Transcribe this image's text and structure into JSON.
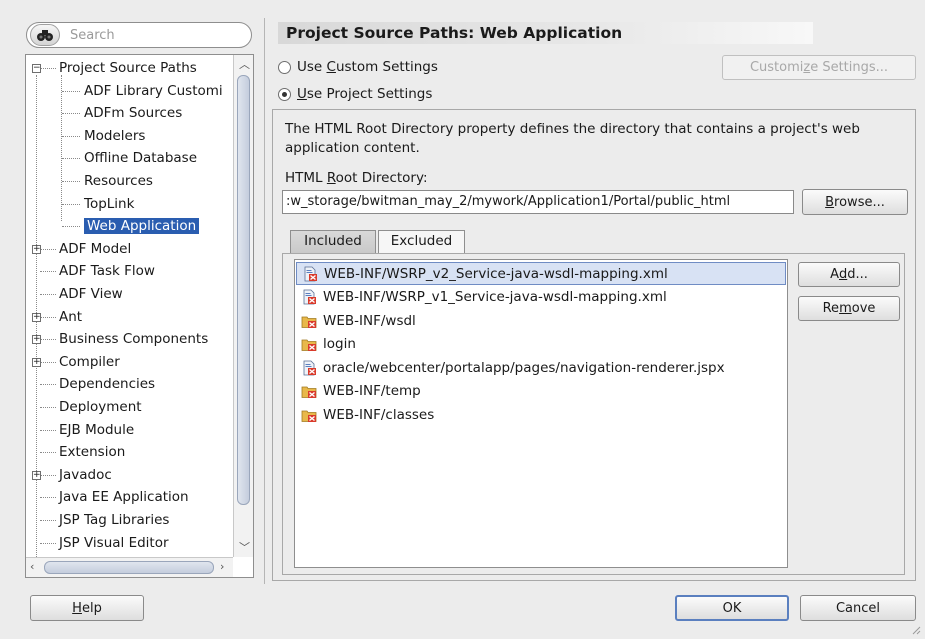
{
  "search": {
    "placeholder": "Search"
  },
  "tree": {
    "items": [
      {
        "label": "Project Source Paths",
        "expander": "-"
      },
      {
        "label": "ADF Library Customi"
      },
      {
        "label": "ADFm Sources"
      },
      {
        "label": "Modelers"
      },
      {
        "label": "Offline Database"
      },
      {
        "label": "Resources"
      },
      {
        "label": "TopLink"
      },
      {
        "label": "Web Application",
        "selected": true
      },
      {
        "label": "ADF Model",
        "expander": "+"
      },
      {
        "label": "ADF Task Flow"
      },
      {
        "label": "ADF View"
      },
      {
        "label": "Ant",
        "expander": "+"
      },
      {
        "label": "Business Components",
        "expander": "+"
      },
      {
        "label": "Compiler",
        "expander": "+"
      },
      {
        "label": "Dependencies"
      },
      {
        "label": "Deployment"
      },
      {
        "label": "EJB Module"
      },
      {
        "label": "Extension"
      },
      {
        "label": "Javadoc",
        "expander": "+"
      },
      {
        "label": "Java EE Application"
      },
      {
        "label": "JSP Tag Libraries"
      },
      {
        "label": "JSP Visual Editor"
      }
    ]
  },
  "panel": {
    "title": "Project Source Paths: Web Application",
    "custom_settings_pre": "Use ",
    "custom_settings_u": "C",
    "custom_settings_post": "ustom Settings",
    "project_settings_u": "U",
    "project_settings_post": "se Project Settings",
    "customize_pre": "Customi",
    "customize_u": "z",
    "customize_post": "e Settings...",
    "description": "The HTML Root Directory property defines the directory that contains a project's web application content.",
    "root_label_pre": "HTML ",
    "root_label_u": "R",
    "root_label_post": "oot Directory:",
    "root_path": ":w_storage/bwitman_may_2/mywork/Application1/Portal/public_html",
    "browse_u": "B",
    "browse_post": "rowse...",
    "tabs": [
      "Included",
      "Excluded"
    ],
    "add_pre": "A",
    "add_u": "d",
    "add_post": "d...",
    "remove_pre": "Re",
    "remove_u": "m",
    "remove_post": "ove",
    "files": [
      {
        "name": "WEB-INF/WSRP_v2_Service-java-wsdl-mapping.xml",
        "icon": "excluded-file-icon",
        "selected": true
      },
      {
        "name": "WEB-INF/WSRP_v1_Service-java-wsdl-mapping.xml",
        "icon": "excluded-file-icon"
      },
      {
        "name": "WEB-INF/wsdl",
        "icon": "excluded-folder-icon"
      },
      {
        "name": "login",
        "icon": "excluded-folder-icon"
      },
      {
        "name": "oracle/webcenter/portalapp/pages/navigation-renderer.jspx",
        "icon": "excluded-file-icon"
      },
      {
        "name": "WEB-INF/temp",
        "icon": "excluded-folder-icon"
      },
      {
        "name": "WEB-INF/classes",
        "icon": "excluded-folder-icon"
      }
    ]
  },
  "footer": {
    "help_u": "H",
    "help_post": "elp",
    "ok_label": "OK",
    "cancel_label": "Cancel"
  },
  "colors": {
    "selection": "#2a5db0",
    "list_selection": "#d8e2f4",
    "background": "#ececec"
  }
}
